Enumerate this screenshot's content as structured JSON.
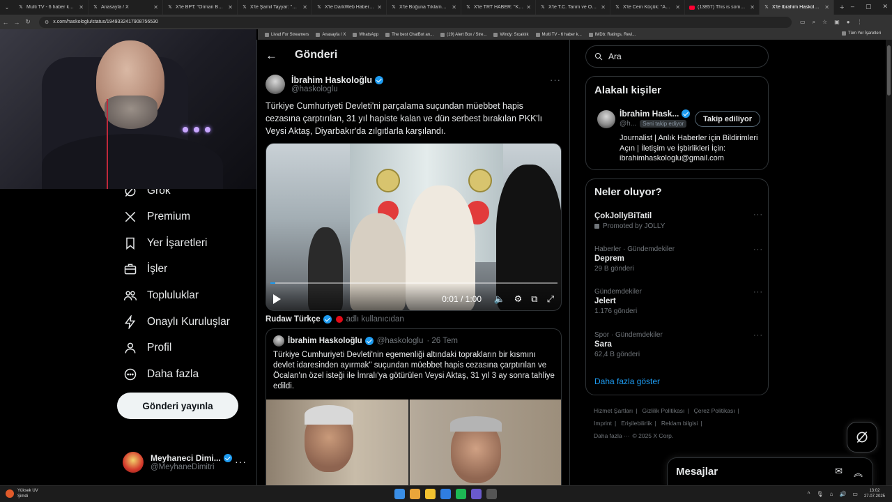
{
  "browser": {
    "tabs": [
      {
        "label": "Multi TV - 6 haber kanalı",
        "icon": "tv-icon"
      },
      {
        "label": "Anasayfa / X",
        "icon": "x-logo-icon"
      },
      {
        "label": "X'te BPT: \"Orman Bakanı",
        "icon": "x-logo-icon"
      },
      {
        "label": "X'te Şamil Tayyar: \"CHP Gr",
        "icon": "x-logo-icon"
      },
      {
        "label": "X'te DarkWeb Haber: \"Lrt",
        "icon": "x-logo-icon"
      },
      {
        "label": "X'te Boğuna Tıklama: \"Lrt",
        "icon": "x-logo-icon"
      },
      {
        "label": "X'te TRT HABER: \"Komand",
        "icon": "x-logo-icon"
      },
      {
        "label": "X'te T.C. Tarım ve Orman",
        "icon": "x-logo-icon"
      },
      {
        "label": "X'te Cem Küçük: \"Abdülk",
        "icon": "x-logo-icon"
      },
      {
        "label": "(13857) This is some funn",
        "icon": "youtube-icon"
      },
      {
        "label": "X'te İbrahim Haskoloğlu",
        "icon": "x-logo-icon"
      }
    ],
    "active_tab_index": 10,
    "url": "x.com/haskologlu/status/1949332417908756530",
    "bookmarks": [
      "Livad For Streamers",
      "Anasayfa / X",
      "WhatsApp",
      "The best ChatBot an...",
      "(19) Alert Box / Stre...",
      "Windy: Sıcaklık",
      "Multi TV - 6 haber k...",
      "IMDb: Ratings, Revi..."
    ],
    "bookmarks_folder": "Tüm Yer İşaretleri"
  },
  "nav": {
    "items": [
      {
        "label": "Grok",
        "icon": "grok-icon"
      },
      {
        "label": "Premium",
        "icon": "x-logo-icon"
      },
      {
        "label": "Yer İşaretleri",
        "icon": "bookmark-icon"
      },
      {
        "label": "İşler",
        "icon": "briefcase-icon"
      },
      {
        "label": "Topluluklar",
        "icon": "people-icon"
      },
      {
        "label": "Onaylı Kuruluşlar",
        "icon": "lightning-icon"
      },
      {
        "label": "Profil",
        "icon": "person-icon"
      },
      {
        "label": "Daha fazla",
        "icon": "more-circle-icon"
      }
    ],
    "post_button": "Gönderi yayınla",
    "account": {
      "name": "Meyhaneci Dimi...",
      "handle": "@MeyhaneDimitri"
    }
  },
  "main": {
    "title": "Gönderi",
    "tweet": {
      "author": "İbrahim Haskoloğlu",
      "handle": "@haskologlu",
      "text": "Türkiye Cumhuriyeti Devleti'ni parçalama suçundan müebbet hapis cezasına çarptırılan, 31 yıl hapiste kalan ve dün serbest bırakılan PKK'lı Veysi Aktaş, Diyarbakır'da zılgıtlarla karşılandı.",
      "video": {
        "time": "0:01 / 1:00",
        "progress": 0.017
      }
    },
    "repost": {
      "name": "Rudaw Türkçe",
      "suffix": "adlı kullanıcıdan"
    },
    "quote": {
      "author": "İbrahim Haskoloğlu",
      "handle": "@haskologlu",
      "date": "· 26 Tem",
      "text": "Türkiye Cumhuriyeti Devleti'nin egemenliği altındaki toprakların bir kısmını devlet idaresinden ayırmak\" suçundan müebbet hapis cezasına çarptırılan ve Öcalan'ın özel isteği ile İmralı'ya götürülen Veysi Aktaş, 31 yıl 3 ay sonra tahliye edildi."
    }
  },
  "right": {
    "search_placeholder": "Ara",
    "related": {
      "title": "Alakalı kişiler",
      "name": "İbrahim Hask...",
      "handle": "@h...",
      "follows_you": "Seni takip ediyor",
      "follow_button": "Takip ediliyor",
      "bio": "Journalist | Anlık Haberler için Bildirimleri Açın | İletişim ve İşbirlikleri İçin: ibrahimhaskologlu@gmail.com"
    },
    "trends": {
      "title": "Neler oluyor?",
      "items": [
        {
          "meta": "",
          "title": "ÇokJollyBiTatil",
          "count": "Promoted by JOLLY",
          "promoted": true
        },
        {
          "meta": "Haberler · Gündemdekiler",
          "title": "Deprem",
          "count": "29 B gönderi",
          "promoted": false
        },
        {
          "meta": "Gündemdekiler",
          "title": "Jelert",
          "count": "1.176 gönderi",
          "promoted": false
        },
        {
          "meta": "Spor · Gündemdekiler",
          "title": "Sara",
          "count": "62,4 B gönderi",
          "promoted": false
        }
      ],
      "show_more": "Daha fazla göster"
    },
    "footer": {
      "links": [
        "Hizmet Şartları",
        "Gizlilik Politikası",
        "Çerez Politikası",
        "Imprint",
        "Erişilebilirlik",
        "Reklam bilgisi",
        "Daha fazla ···"
      ],
      "copyright": "© 2025 X Corp."
    },
    "messages_title": "Mesajlar"
  },
  "taskbar": {
    "weather_title": "Yüksek UV",
    "weather_sub": "Şimdi",
    "time": "13:02",
    "date": "27.07.2025"
  },
  "colors": {
    "accent": "#1d9bf0",
    "background": "#000000",
    "border": "#2f3336",
    "muted": "#71767b",
    "text": "#e7e9ea"
  }
}
